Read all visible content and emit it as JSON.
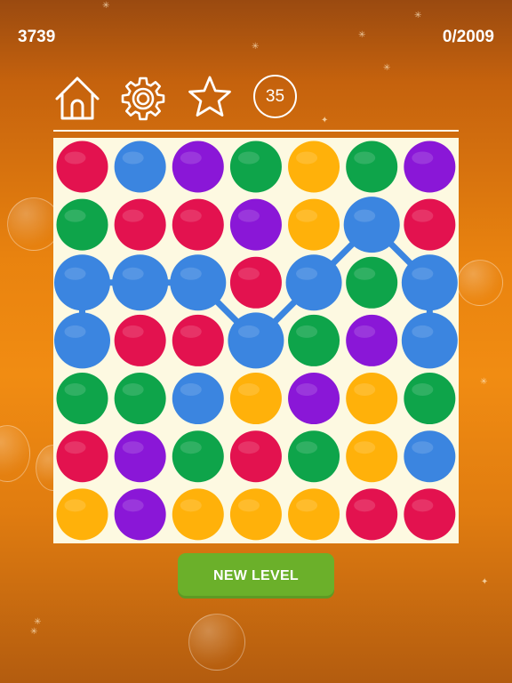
{
  "hud": {
    "score": "3739",
    "progress": "0/2009"
  },
  "toolbar": {
    "home_icon": "house-icon",
    "settings_icon": "gear-icon",
    "rate_icon": "star-icon",
    "moves_left": "35"
  },
  "colors": {
    "red": "#e3124f",
    "blue": "#3b85e0",
    "purple": "#8a17d7",
    "green": "#0ea44a",
    "orange": "#ffb10a"
  },
  "board": {
    "rows": 7,
    "cols": 7,
    "grid": [
      [
        "red",
        "blue",
        "purple",
        "green",
        "orange",
        "green",
        "purple"
      ],
      [
        "green",
        "red",
        "red",
        "purple",
        "orange",
        "blue",
        "red"
      ],
      [
        "blue",
        "blue",
        "blue",
        "red",
        "blue",
        "green",
        "blue"
      ],
      [
        "blue",
        "red",
        "red",
        "blue",
        "green",
        "purple",
        "blue"
      ],
      [
        "green",
        "green",
        "blue",
        "orange",
        "purple",
        "orange",
        "green"
      ],
      [
        "red",
        "purple",
        "green",
        "red",
        "green",
        "orange",
        "blue"
      ],
      [
        "orange",
        "purple",
        "orange",
        "orange",
        "orange",
        "red",
        "red"
      ]
    ],
    "selected_path": [
      [
        3,
        0
      ],
      [
        2,
        0
      ],
      [
        2,
        1
      ],
      [
        2,
        2
      ],
      [
        3,
        3
      ],
      [
        2,
        4
      ],
      [
        1,
        5
      ],
      [
        2,
        6
      ],
      [
        3,
        6
      ]
    ]
  },
  "new_level_label": "NEW LEVEL"
}
